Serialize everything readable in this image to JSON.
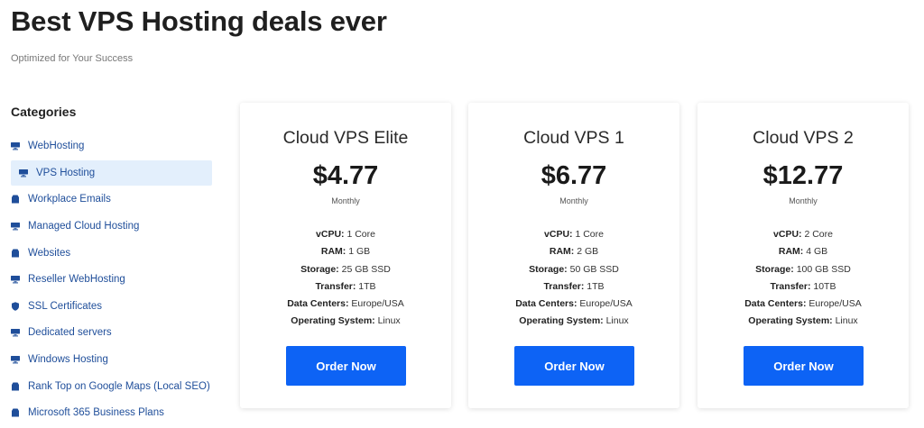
{
  "header": {
    "title": "Best VPS Hosting deals ever",
    "subtitle": "Optimized for Your Success"
  },
  "sidebar": {
    "title": "Categories",
    "items": [
      {
        "label": "WebHosting",
        "icon": "server-icon",
        "active": false
      },
      {
        "label": "VPS Hosting",
        "icon": "server-icon",
        "active": true
      },
      {
        "label": "Workplace Emails",
        "icon": "box-icon",
        "active": false
      },
      {
        "label": "Managed Cloud Hosting",
        "icon": "server-icon",
        "active": false
      },
      {
        "label": "Websites",
        "icon": "box-icon",
        "active": false
      },
      {
        "label": "Reseller WebHosting",
        "icon": "server-icon",
        "active": false
      },
      {
        "label": "SSL Certificates",
        "icon": "shield-icon",
        "active": false
      },
      {
        "label": "Dedicated servers",
        "icon": "server-icon",
        "active": false
      },
      {
        "label": "Windows Hosting",
        "icon": "server-icon",
        "active": false
      },
      {
        "label": "Rank Top on Google Maps (Local SEO)",
        "icon": "box-icon",
        "active": false
      },
      {
        "label": "Microsoft 365 Business Plans",
        "icon": "box-icon",
        "active": false
      }
    ]
  },
  "plans": [
    {
      "name": "Cloud VPS Elite",
      "price": "$4.77",
      "period": "Monthly",
      "specs": [
        {
          "label": "vCPU:",
          "value": "1 Core"
        },
        {
          "label": "RAM:",
          "value": "1 GB"
        },
        {
          "label": "Storage:",
          "value": "25 GB SSD"
        },
        {
          "label": "Transfer:",
          "value": "1TB"
        },
        {
          "label": "Data Centers:",
          "value": "Europe/USA"
        },
        {
          "label": "Operating System:",
          "value": "Linux"
        }
      ],
      "button": "Order Now"
    },
    {
      "name": "Cloud VPS 1",
      "price": "$6.77",
      "period": "Monthly",
      "specs": [
        {
          "label": "vCPU:",
          "value": "1 Core"
        },
        {
          "label": "RAM:",
          "value": "2 GB"
        },
        {
          "label": "Storage:",
          "value": "50 GB SSD"
        },
        {
          "label": "Transfer:",
          "value": "1TB"
        },
        {
          "label": "Data Centers:",
          "value": "Europe/USA"
        },
        {
          "label": "Operating System:",
          "value": "Linux"
        }
      ],
      "button": "Order Now"
    },
    {
      "name": "Cloud VPS 2",
      "price": "$12.77",
      "period": "Monthly",
      "specs": [
        {
          "label": "vCPU:",
          "value": "2 Core"
        },
        {
          "label": "RAM:",
          "value": "4 GB"
        },
        {
          "label": "Storage:",
          "value": "100 GB SSD"
        },
        {
          "label": "Transfer:",
          "value": "10TB"
        },
        {
          "label": "Data Centers:",
          "value": "Europe/USA"
        },
        {
          "label": "Operating System:",
          "value": "Linux"
        }
      ],
      "button": "Order Now"
    }
  ],
  "colors": {
    "accent": "#0d63f5",
    "link": "#1f4e9a",
    "active_bg": "#e3effc"
  }
}
